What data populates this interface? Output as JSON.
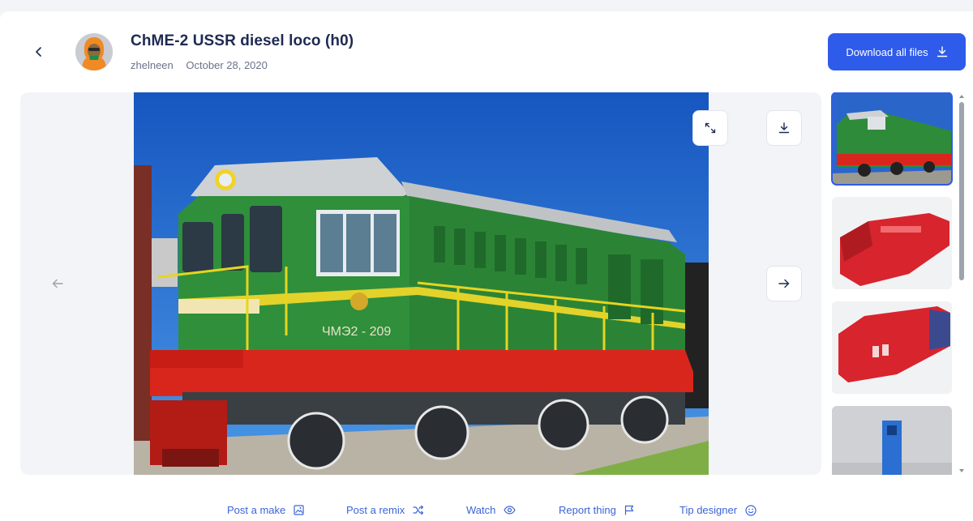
{
  "header": {
    "title": "ChME-2 USSR diesel loco (h0)",
    "author": "zhelneen",
    "date": "October 28, 2020",
    "download_all_label": "Download all files"
  },
  "icons": {
    "back": "chevron-left-icon",
    "download": "download-icon",
    "expand": "expand-icon",
    "prev": "arrow-left-icon",
    "next": "arrow-right-icon"
  },
  "gallery": {
    "main_image_number_plate": "ЧМЭ2-209",
    "thumbnails": [
      {
        "name": "photo-green-loco",
        "active": true
      },
      {
        "name": "render-red-body-1",
        "active": false
      },
      {
        "name": "render-red-body-2",
        "active": false
      },
      {
        "name": "render-blue-part",
        "active": false
      }
    ]
  },
  "actions": [
    {
      "label": "Post a make",
      "icon": "image-icon"
    },
    {
      "label": "Post a remix",
      "icon": "shuffle-icon"
    },
    {
      "label": "Watch",
      "icon": "eye-icon"
    },
    {
      "label": "Report thing",
      "icon": "flag-icon"
    },
    {
      "label": "Tip designer",
      "icon": "smile-icon"
    }
  ],
  "colors": {
    "accent": "#2f5bea",
    "title": "#1e2a52",
    "link": "#3d63d8",
    "loco_green": "#2e8b3a",
    "loco_red": "#d9261c",
    "sky": "#1f6fd1"
  }
}
